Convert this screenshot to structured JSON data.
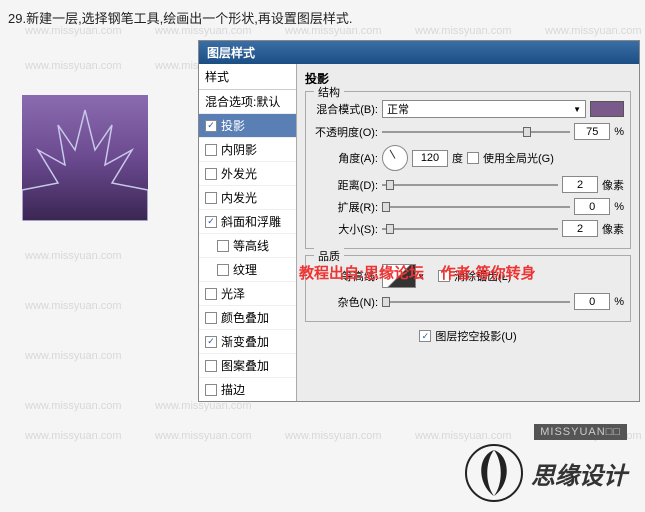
{
  "instruction": "29.新建一层,选择钢笔工具,绘画出一个形状,再设置图层样式.",
  "watermark_text": "www.missyuan.com",
  "dialog": {
    "title": "图层样式",
    "sidebar_header": "样式",
    "items": [
      {
        "label": "混合选项:默认",
        "checked": null
      },
      {
        "label": "投影",
        "checked": true,
        "selected": true
      },
      {
        "label": "内阴影",
        "checked": false
      },
      {
        "label": "外发光",
        "checked": false
      },
      {
        "label": "内发光",
        "checked": false
      },
      {
        "label": "斜面和浮雕",
        "checked": true
      },
      {
        "label": "等高线",
        "checked": false,
        "indent": true
      },
      {
        "label": "纹理",
        "checked": false,
        "indent": true
      },
      {
        "label": "光泽",
        "checked": false
      },
      {
        "label": "颜色叠加",
        "checked": false
      },
      {
        "label": "渐变叠加",
        "checked": true
      },
      {
        "label": "图案叠加",
        "checked": false
      },
      {
        "label": "描边",
        "checked": false
      }
    ]
  },
  "panel": {
    "title": "投影",
    "structure_legend": "结构",
    "blend_label": "混合模式(B):",
    "blend_value": "正常",
    "opacity_label": "不透明度(O):",
    "opacity_value": "75",
    "percent": "%",
    "angle_label": "角度(A):",
    "angle_value": "120",
    "degree": "度",
    "global_light": "使用全局光(G)",
    "distance_label": "距离(D):",
    "distance_value": "2",
    "px": "像素",
    "spread_label": "扩展(R):",
    "spread_value": "0",
    "size_label": "大小(S):",
    "size_value": "2",
    "quality_legend": "品质",
    "contour_label": "等高线:",
    "antialias": "消除锯齿(L)",
    "noise_label": "杂色(N):",
    "noise_value": "0",
    "knockout": "图层挖空投影(U)"
  },
  "overlay": {
    "tutorial": "教程出自:思缘论坛",
    "author": "作者:等你转身"
  },
  "footer": {
    "brand_bar": "MISSYUAN□□",
    "logo_text": "思缘设计"
  }
}
